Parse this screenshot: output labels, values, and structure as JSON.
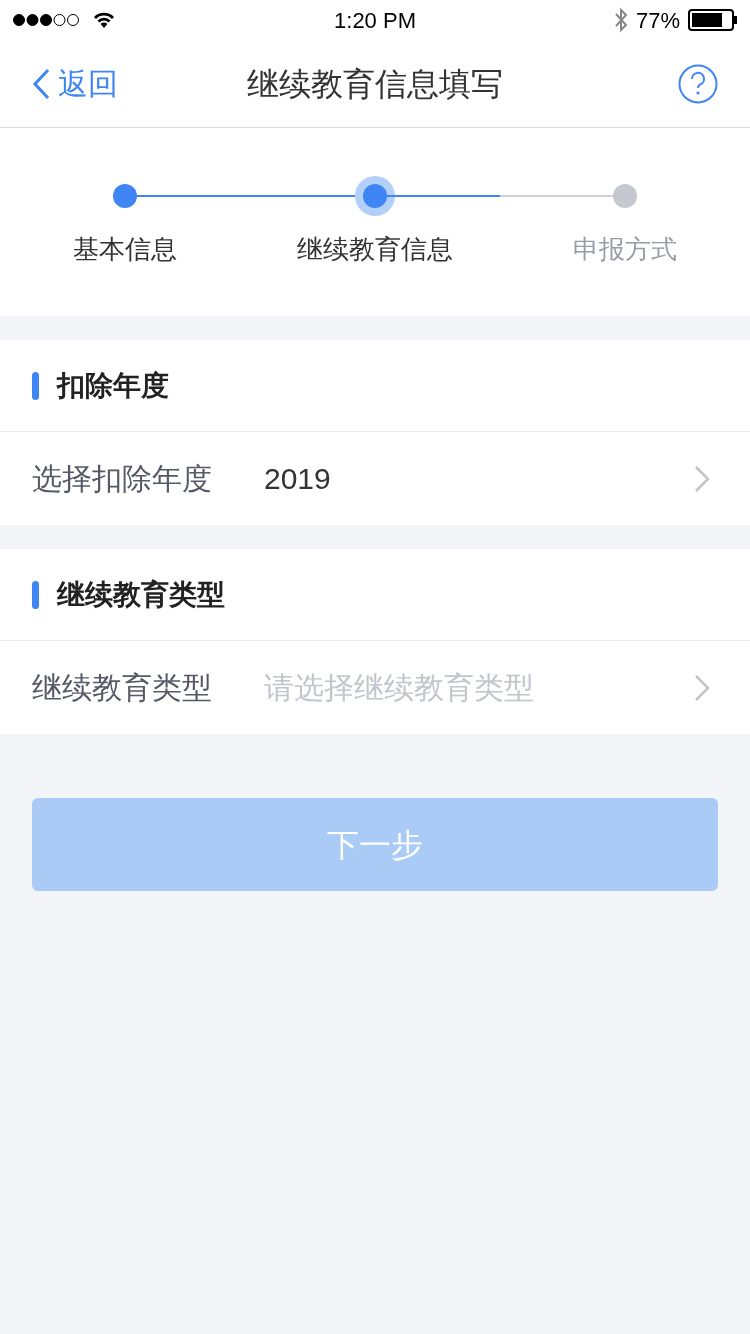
{
  "status_bar": {
    "time": "1:20 PM",
    "battery": "77%"
  },
  "nav": {
    "back": "返回",
    "title": "继续教育信息填写"
  },
  "steps": [
    {
      "label": "基本信息",
      "done": true,
      "selected": false
    },
    {
      "label": "继续教育信息",
      "done": false,
      "selected": true
    },
    {
      "label": "申报方式",
      "done": false,
      "selected": false
    }
  ],
  "sections": [
    {
      "title": "扣除年度",
      "row": {
        "label": "选择扣除年度",
        "value": "2019"
      }
    },
    {
      "title": "继续教育类型",
      "row": {
        "label": "继续教育类型",
        "placeholder": "请选择继续教育类型"
      }
    }
  ],
  "next_button": {
    "label": "下一步",
    "disabled": true
  }
}
